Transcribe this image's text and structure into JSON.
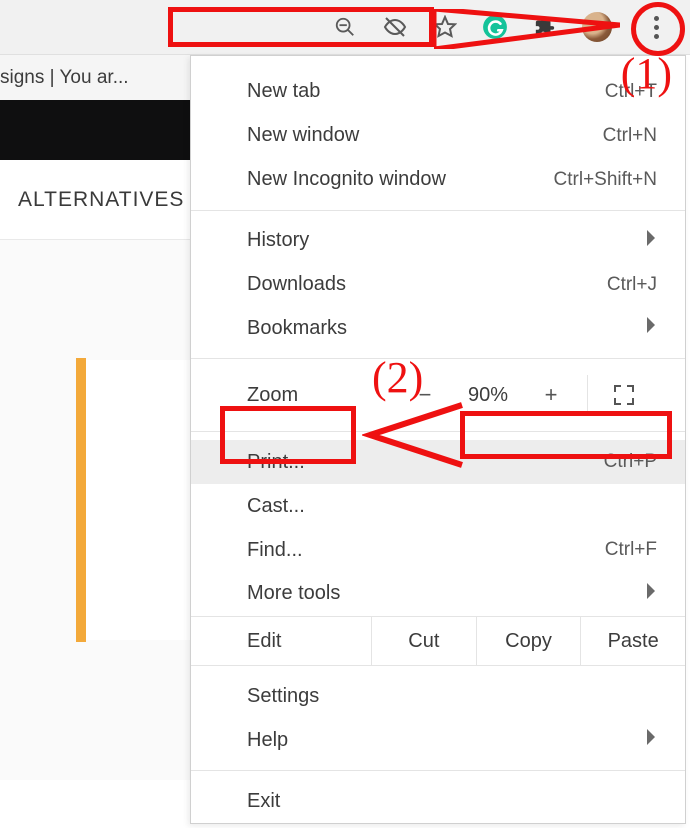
{
  "toolbar": {
    "tab_title": "signs | You ar..."
  },
  "page": {
    "heading": "ALTERNATIVES"
  },
  "menu": {
    "new_tab": {
      "label": "New tab",
      "shortcut": "Ctrl+T"
    },
    "new_window": {
      "label": "New window",
      "shortcut": "Ctrl+N"
    },
    "new_incognito": {
      "label": "New Incognito window",
      "shortcut": "Ctrl+Shift+N"
    },
    "history": {
      "label": "History"
    },
    "downloads": {
      "label": "Downloads",
      "shortcut": "Ctrl+J"
    },
    "bookmarks": {
      "label": "Bookmarks"
    },
    "zoom": {
      "label": "Zoom",
      "value": "90%",
      "plus": "+",
      "minus": "−"
    },
    "print": {
      "label": "Print...",
      "shortcut": "Ctrl+P"
    },
    "cast": {
      "label": "Cast..."
    },
    "find": {
      "label": "Find...",
      "shortcut": "Ctrl+F"
    },
    "more_tools": {
      "label": "More tools"
    },
    "edit": {
      "label": "Edit",
      "cut": "Cut",
      "copy": "Copy",
      "paste": "Paste"
    },
    "settings": {
      "label": "Settings"
    },
    "help": {
      "label": "Help"
    },
    "exit": {
      "label": "Exit"
    }
  },
  "annotations": {
    "num1": "(1)",
    "num2": "(2)"
  }
}
